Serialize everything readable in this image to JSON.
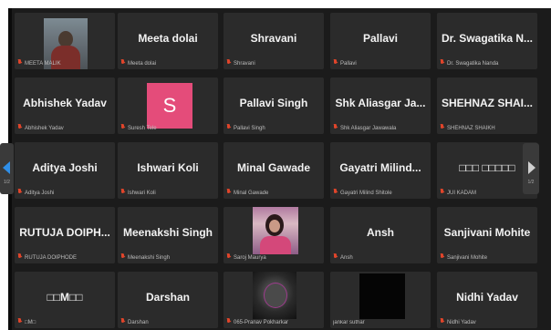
{
  "participants": [
    {
      "tile": "Meeta Malik",
      "caption": "MEETA MALIK",
      "kind": "photo"
    },
    {
      "tile": "Meeta dolai",
      "caption": "Meeta dolai",
      "kind": "name"
    },
    {
      "tile": "Shravani",
      "caption": "Shravani",
      "kind": "name"
    },
    {
      "tile": "Pallavi",
      "caption": "Pallavi",
      "kind": "name"
    },
    {
      "tile": "Dr. Swagatika N...",
      "caption": "Dr. Swagatika Nanda",
      "kind": "name"
    },
    {
      "tile": "Abhishek Yadav",
      "caption": "Abhishek Yadav",
      "kind": "name"
    },
    {
      "tile": "S",
      "caption": "Suresh Tele",
      "kind": "avatar"
    },
    {
      "tile": "Pallavi Singh",
      "caption": "Pallavi Singh",
      "kind": "name"
    },
    {
      "tile": "Shk Aliasgar Ja...",
      "caption": "Shk Aliasgar Jawawala",
      "kind": "name"
    },
    {
      "tile": "SHEHNAZ SHAI...",
      "caption": "SHEHNAZ SHAIKH",
      "kind": "name"
    },
    {
      "tile": "Aditya Joshi",
      "caption": "Aditya Joshi",
      "kind": "name"
    },
    {
      "tile": "Ishwari Koli",
      "caption": "Ishwari Koli",
      "kind": "name"
    },
    {
      "tile": "Minal Gawade",
      "caption": "Minal Gawade",
      "kind": "name"
    },
    {
      "tile": "Gayatri Milind...",
      "caption": "Gayatri Milind Shitole",
      "kind": "name"
    },
    {
      "tile": "□□□ □□□□□",
      "caption": "JUI KADAM",
      "kind": "name"
    },
    {
      "tile": "RUTUJA DOIPH...",
      "caption": "RUTUJA DOIPHODE",
      "kind": "name"
    },
    {
      "tile": "Meenakshi Singh",
      "caption": "Meenakshi Singh",
      "kind": "name"
    },
    {
      "tile": "Saroj Maurya",
      "caption": "Saroj Maurya",
      "kind": "photo2"
    },
    {
      "tile": "Ansh",
      "caption": "Ansh",
      "kind": "name"
    },
    {
      "tile": "Sanjivani Mohite",
      "caption": "Sanjivani Mohite",
      "kind": "name"
    },
    {
      "tile": "□□M□□",
      "caption": "□M□",
      "kind": "name"
    },
    {
      "tile": "Darshan",
      "caption": "Darshan",
      "kind": "name"
    },
    {
      "tile": "065-Pranav Pokharkar",
      "caption": "065-Pranav Pokharkar",
      "kind": "photo3"
    },
    {
      "tile": "jankar suthar",
      "caption": "jankar suthar",
      "kind": "black"
    },
    {
      "tile": "Nidhi Yadav",
      "caption": "Nidhi Yadav",
      "kind": "name"
    }
  ],
  "nav": {
    "prev_icon": "chevron-left-icon",
    "next_icon": "chevron-right-icon",
    "page_left": "1/2",
    "page_right": "1/2"
  },
  "colors": {
    "background": "#1b1b1b",
    "tile": "#2b2b2b",
    "avatar": "#e44c7a",
    "mic": "#e0452b",
    "nav_left_accent": "#2f8fe8"
  }
}
